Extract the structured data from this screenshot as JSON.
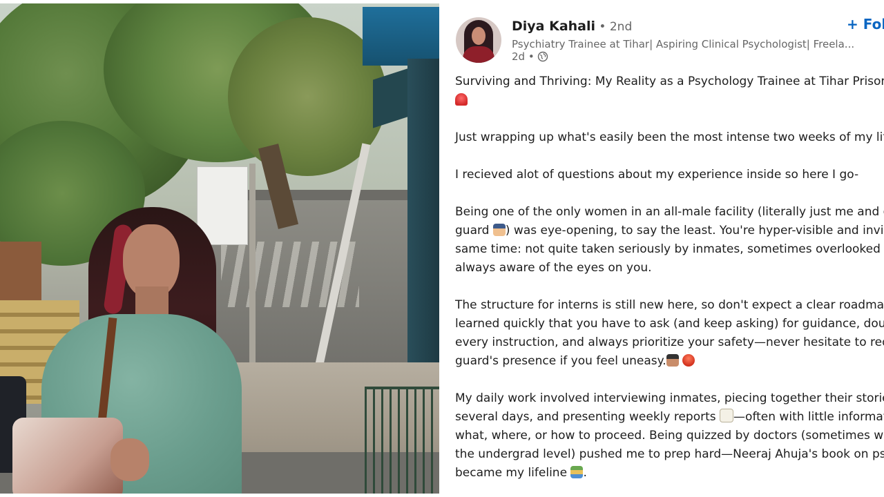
{
  "post": {
    "author_name": "Diya Kahali",
    "connection_degree": " • 2nd",
    "headline": "Psychiatry Trainee at Tihar| Aspiring Clinical Psychologist| Freela...",
    "time_ago": "2d •",
    "follow_label": "+ Fol",
    "colors": {
      "follow": "#0a66c2",
      "text": "#1d1d1d",
      "muted": "#666666"
    },
    "lines": {
      "title": "Surviving and Thriving: My Reality as a Psychology Trainee at Tihar Prison (",
      "p1": "Just wrapping up what's easily been the most intense two weeks of my life",
      "p2": "I recieved alot of questions about my experience inside so here I go-",
      "p3_l1": "Being one of the only women in an all-male facility (literally just me and or",
      "p3_l2a": "guard ",
      "p3_l2b": ") was eye-opening, to say the least. You're hyper-visible and invis",
      "p3_l3": "same time: not quite taken seriously by inmates, sometimes overlooked by",
      "p3_l4": "always aware of the eyes on you.",
      "p4_l1": "The structure for interns is still new here, so don't expect a clear roadmap",
      "p4_l2": "learned quickly that you have to ask (and keep asking) for guidance, doub",
      "p4_l3": "every instruction, and always prioritize your safety—never hesitate to requ",
      "p4_l4": "guard's presence if you feel uneasy.",
      "p5_l1": "My daily work involved interviewing inmates, piecing together their stories",
      "p5_l2a": "several days, and presenting weekly reports ",
      "p5_l2b": "—often with little informat",
      "p5_l3": "what, where, or how to proceed. Being quizzed by doctors (sometimes wel",
      "p5_l4": "the undergrad level) pushed me to prep hard—Neeraj Ahuja's book on psy",
      "p5_l5": "became my lifeline "
    },
    "emojis": [
      "siren-emoji",
      "police-officer-emoji",
      "guard-emoji",
      "rescue-helmet-emoji",
      "memo-emoji",
      "books-emoji"
    ]
  }
}
